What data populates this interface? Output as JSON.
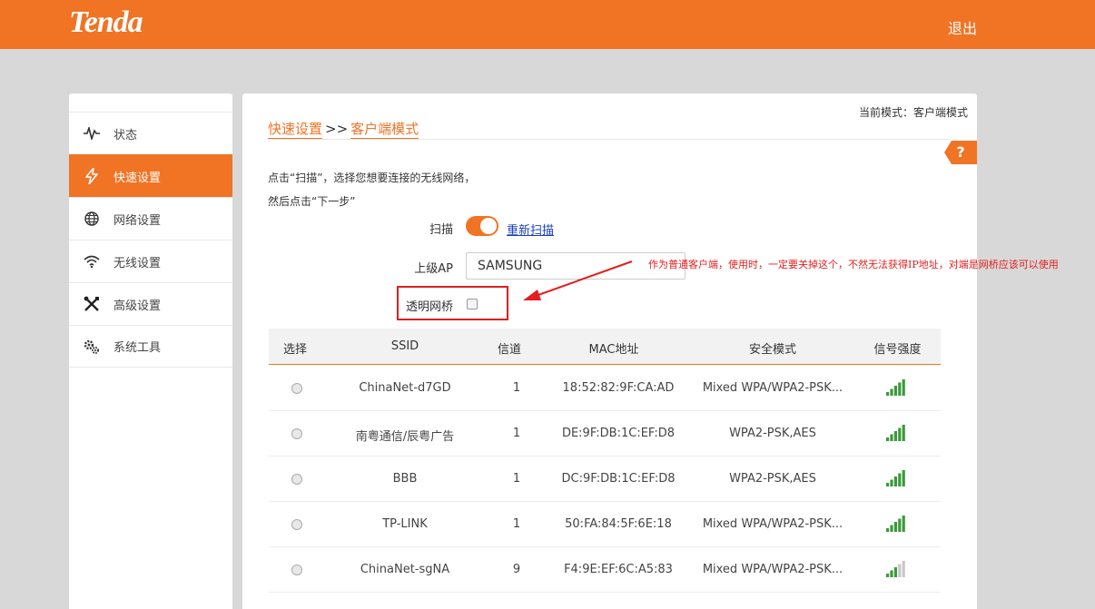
{
  "header": {
    "logo": "Tenda",
    "logout": "退出"
  },
  "sidebar": {
    "items": [
      {
        "label": "状态",
        "icon": "pulse-icon",
        "active": false
      },
      {
        "label": "快速设置",
        "icon": "lightning-icon",
        "active": true
      },
      {
        "label": "网络设置",
        "icon": "globe-icon",
        "active": false
      },
      {
        "label": "无线设置",
        "icon": "wifi-icon",
        "active": false
      },
      {
        "label": "高级设置",
        "icon": "tools-icon",
        "active": false
      },
      {
        "label": "系统工具",
        "icon": "gears-icon",
        "active": false
      }
    ]
  },
  "main": {
    "mode": "当前模式：客户端模式",
    "breadcrumb": {
      "first": "快速设置",
      "sep": ">>",
      "second": "客户端模式"
    },
    "help": "?",
    "desc1": "点击“扫描”，选择您想要连接的无线网络，",
    "desc2": "然后点击“下一步”",
    "scan_label": "扫描",
    "scan_on": true,
    "rescan": "重新扫描",
    "ap_label": "上级AP",
    "ap_value": "SAMSUNG",
    "bridge_label": "透明网桥",
    "bridge_checked": false,
    "annotation": "作为普通客户端，使用时，一定要关掉这个，不然无法获得IP地址，对端是网桥应该可以使用",
    "table": {
      "headers": [
        "选择",
        "SSID",
        "信道",
        "MAC地址",
        "安全模式",
        "信号强度"
      ],
      "rows": [
        {
          "ssid": "ChinaNet-d7GD",
          "channel": "1",
          "mac": "18:52:82:9F:CA:AD",
          "security": "Mixed WPA/WPA2-PSK...",
          "signal": 5
        },
        {
          "ssid": "南粤通信/辰粤广告",
          "channel": "1",
          "mac": "DE:9F:DB:1C:EF:D8",
          "security": "WPA2-PSK,AES",
          "signal": 5
        },
        {
          "ssid": "BBB",
          "channel": "1",
          "mac": "DC:9F:DB:1C:EF:D8",
          "security": "WPA2-PSK,AES",
          "signal": 5
        },
        {
          "ssid": "TP-LINK",
          "channel": "1",
          "mac": "50:FA:84:5F:6E:18",
          "security": "Mixed WPA/WPA2-PSK...",
          "signal": 5
        },
        {
          "ssid": "ChinaNet-sgNA",
          "channel": "9",
          "mac": "F4:9E:EF:6C:A5:83",
          "security": "Mixed WPA/WPA2-PSK...",
          "signal": 3
        }
      ]
    }
  },
  "colors": {
    "accent": "#f07424",
    "annotation": "#e41e1e",
    "signal_on": "#3a9a3a",
    "signal_off": "#c8c8c8"
  }
}
